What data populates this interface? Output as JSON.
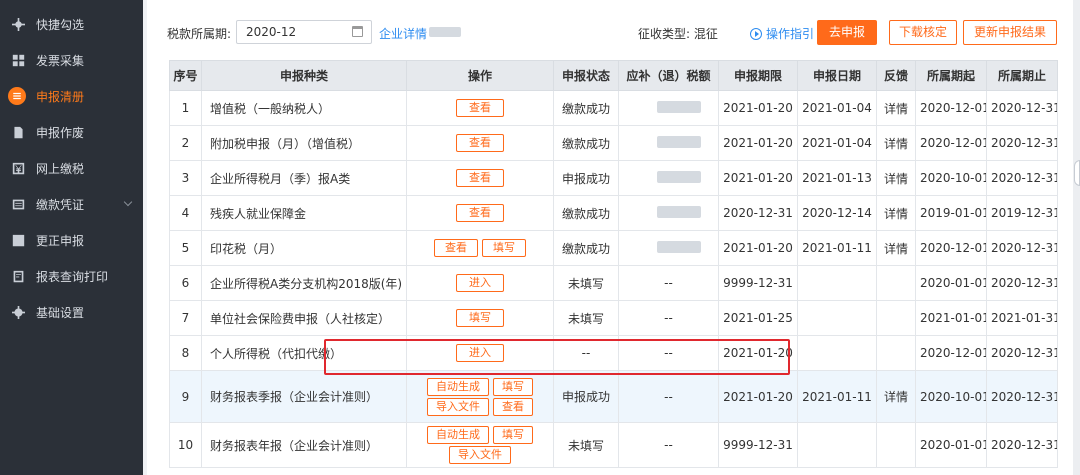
{
  "sidebar": {
    "items": [
      {
        "label": "快捷勾选",
        "icon": "gear-icon",
        "active": false
      },
      {
        "label": "发票采集",
        "icon": "grid-icon",
        "active": false
      },
      {
        "label": "申报清册",
        "icon": "list-icon",
        "active": true
      },
      {
        "label": "申报作废",
        "icon": "document-icon",
        "active": false
      },
      {
        "label": "网上缴税",
        "icon": "yen-icon",
        "active": false
      },
      {
        "label": "缴款凭证",
        "icon": "receipt-icon",
        "active": false,
        "has_caret": true
      },
      {
        "label": "更正申报",
        "icon": "edit-icon",
        "active": false
      },
      {
        "label": "报表查询打印",
        "icon": "print-icon",
        "active": false
      },
      {
        "label": "基础设置",
        "icon": "settings-icon",
        "active": false
      }
    ]
  },
  "toolbar": {
    "period_label": "税款所属期:",
    "period_value": "2020-12",
    "enterprise_link": "企业详情",
    "tax_type": "征收类型: 混征",
    "guide_link": "操作指引",
    "declare_button": "去申报",
    "download_button": "下载核定",
    "update_button": "更新申报结果"
  },
  "table": {
    "headers": [
      "序号",
      "申报种类",
      "操作",
      "申报状态",
      "应补（退）税额",
      "申报期限",
      "申报日期",
      "反馈",
      "所属期起",
      "所属期止"
    ],
    "rows": [
      {
        "no": "1",
        "type": "增值税（一般纳税人）",
        "ops": [
          "查看"
        ],
        "status": "缴款成功",
        "status_red": false,
        "amount": "",
        "deadline": "2021-01-20",
        "date": "2021-01-04",
        "feedback": "详情",
        "start": "2020-12-01",
        "end": "2020-12-31"
      },
      {
        "no": "2",
        "type": "附加税申报（月）（增值税）",
        "ops": [
          "查看"
        ],
        "status": "缴款成功",
        "status_red": false,
        "amount": "",
        "deadline": "2021-01-20",
        "date": "2021-01-04",
        "feedback": "详情",
        "start": "2020-12-01",
        "end": "2020-12-31"
      },
      {
        "no": "3",
        "type": "企业所得税月（季）报A类",
        "ops": [
          "查看"
        ],
        "status": "申报成功",
        "status_red": false,
        "amount": "",
        "deadline": "2021-01-20",
        "date": "2021-01-13",
        "feedback": "详情",
        "start": "2020-10-01",
        "end": "2020-12-31"
      },
      {
        "no": "4",
        "type": "残疾人就业保障金",
        "ops": [
          "查看"
        ],
        "status": "缴款成功",
        "status_red": false,
        "amount": "",
        "deadline": "2020-12-31",
        "date": "2020-12-14",
        "feedback": "详情",
        "start": "2019-01-01",
        "end": "2019-12-31"
      },
      {
        "no": "5",
        "type": "印花税（月）",
        "ops": [
          "查看",
          "填写"
        ],
        "status": "缴款成功",
        "status_red": false,
        "amount": "",
        "deadline": "2021-01-20",
        "date": "2021-01-11",
        "feedback": "详情",
        "start": "2020-12-01",
        "end": "2020-12-31"
      },
      {
        "no": "6",
        "type": "企业所得税A类分支机构2018版(年)",
        "ops": [
          "进入"
        ],
        "status": "未填写",
        "status_red": true,
        "amount": "--",
        "deadline": "9999-12-31",
        "date": "",
        "feedback": "",
        "start": "2020-01-01",
        "end": "2020-12-31"
      },
      {
        "no": "7",
        "type": "单位社会保险费申报（人社核定）",
        "ops": [
          "填写"
        ],
        "status": "未填写",
        "status_red": true,
        "amount": "--",
        "deadline": "2021-01-25",
        "date": "",
        "feedback": "",
        "start": "2021-01-01",
        "end": "2021-01-31"
      },
      {
        "no": "8",
        "type": "个人所得税（代扣代缴）",
        "ops": [
          "进入"
        ],
        "status": "--",
        "status_red": false,
        "amount": "--",
        "deadline": "2021-01-20",
        "date": "",
        "feedback": "",
        "start": "2020-12-01",
        "end": "2020-12-31"
      },
      {
        "no": "9",
        "type": "财务报表季报（企业会计准则）",
        "ops": [
          "自动生成",
          "填写",
          "导入文件",
          "查看"
        ],
        "status": "申报成功",
        "status_red": false,
        "amount": "--",
        "deadline": "2021-01-20",
        "date": "2021-01-11",
        "feedback": "详情",
        "start": "2020-10-01",
        "end": "2020-12-31"
      },
      {
        "no": "10",
        "type": "财务报表年报（企业会计准则）",
        "ops": [
          "自动生成",
          "填写",
          "导入文件"
        ],
        "status": "未填写",
        "status_red": true,
        "amount": "--",
        "deadline": "9999-12-31",
        "date": "",
        "feedback": "",
        "start": "2020-01-01",
        "end": "2020-12-31"
      }
    ]
  },
  "colors": {
    "accent": "#ff6a1a",
    "link": "#2d8cf0",
    "danger": "#e0282e",
    "sidebar_bg": "#2b3038"
  }
}
